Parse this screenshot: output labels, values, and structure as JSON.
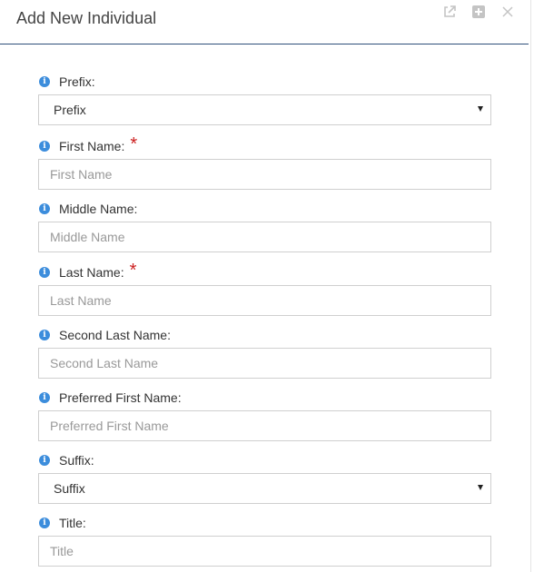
{
  "dialog": {
    "title": "Add New Individual",
    "icons": [
      "external-link-icon",
      "plus-square-icon",
      "close-icon"
    ]
  },
  "fields": [
    {
      "label": "Prefix:",
      "type": "select",
      "value": "Prefix",
      "required": false
    },
    {
      "label": "First Name:",
      "type": "text",
      "placeholder": "First Name",
      "required": true
    },
    {
      "label": "Middle Name:",
      "type": "text",
      "placeholder": "Middle Name",
      "required": false
    },
    {
      "label": "Last Name:",
      "type": "text",
      "placeholder": "Last Name",
      "required": true
    },
    {
      "label": "Second Last Name:",
      "type": "text",
      "placeholder": "Second Last Name",
      "required": false
    },
    {
      "label": "Preferred First Name:",
      "type": "text",
      "placeholder": "Preferred First Name",
      "required": false
    },
    {
      "label": "Suffix:",
      "type": "select",
      "value": "Suffix",
      "required": false
    },
    {
      "label": "Title:",
      "type": "text",
      "placeholder": "Title",
      "required": false
    }
  ],
  "colors": {
    "info": "#3c8ddc",
    "required": "#cc1f1f",
    "header_rule": "#2f4f7a"
  },
  "required_mark": "*"
}
